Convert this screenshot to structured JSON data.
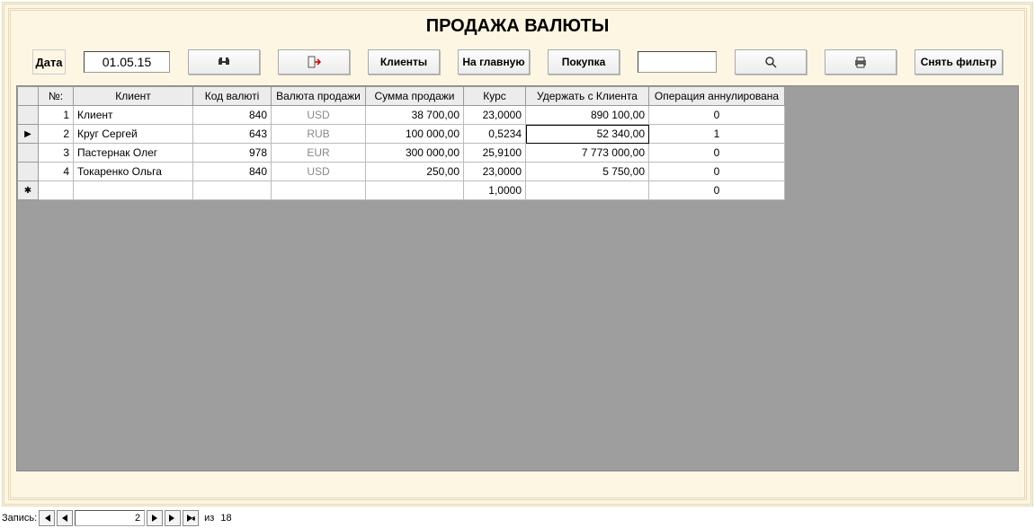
{
  "title": "ПРОДАЖА ВАЛЮТЫ",
  "toolbar": {
    "date_label": "Дата",
    "date_value": "01.05.15",
    "clients_btn": "Клиенты",
    "home_btn": "На главную",
    "buy_btn": "Покупка",
    "search_value": "",
    "clear_filter_btn": "Снять фильтр"
  },
  "grid": {
    "headers": {
      "num": "№:",
      "client": "Клиент",
      "code": "Код валюті",
      "currency": "Валюта продажи",
      "sum": "Сумма продажи",
      "rate": "Курс",
      "hold": "Удержать с Клиента",
      "annulled": "Операция аннулирована"
    },
    "rows": [
      {
        "num": "1",
        "client": "Клиент",
        "code": "840",
        "currency": "USD",
        "sum": "38 700,00",
        "rate": "23,0000",
        "hold": "890 100,00",
        "annulled": "0",
        "selector": ""
      },
      {
        "num": "2",
        "client": "Круг Сергей",
        "code": "643",
        "currency": "RUB",
        "sum": "100 000,00",
        "rate": "0,5234",
        "hold": "52 340,00",
        "annulled": "1",
        "selector": "▶"
      },
      {
        "num": "3",
        "client": "Пастернак Олег",
        "code": "978",
        "currency": "EUR",
        "sum": "300 000,00",
        "rate": "25,9100",
        "hold": "7 773 000,00",
        "annulled": "0",
        "selector": ""
      },
      {
        "num": "4",
        "client": "Токаренко Ольга",
        "code": "840",
        "currency": "USD",
        "sum": "250,00",
        "rate": "23,0000",
        "hold": "5 750,00",
        "annulled": "0",
        "selector": ""
      }
    ],
    "new_row": {
      "selector": "✱",
      "rate": "1,0000",
      "annulled": "0"
    }
  },
  "recnav": {
    "label": "Запись:",
    "current": "2",
    "of_label": "из",
    "total": "18"
  }
}
